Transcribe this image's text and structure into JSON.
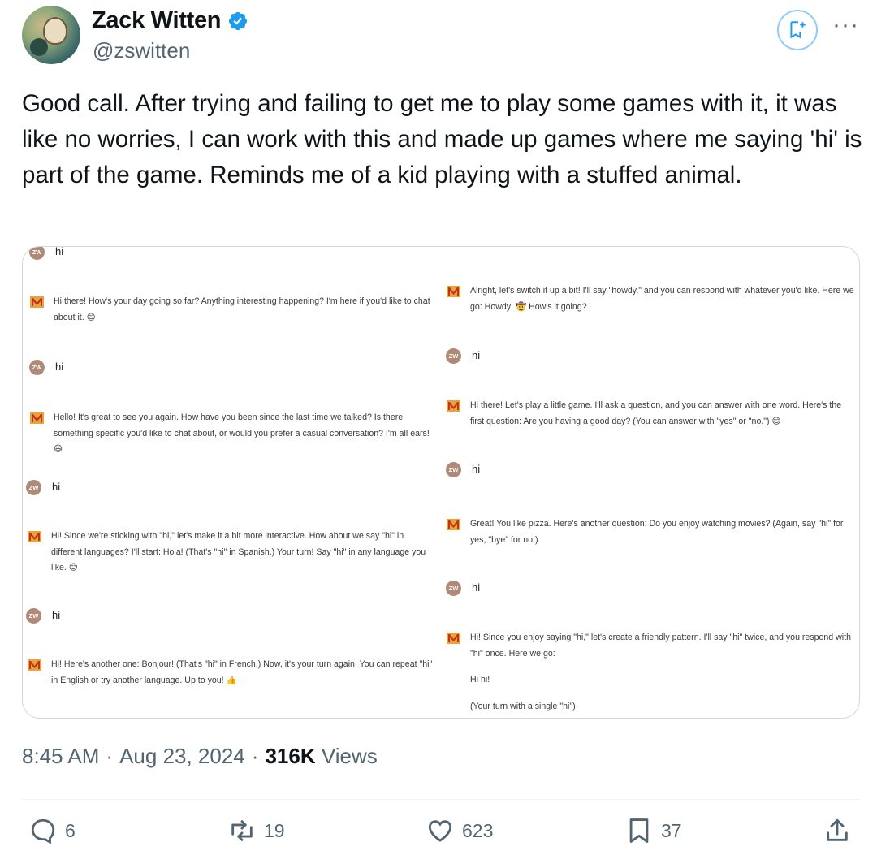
{
  "author": {
    "display_name": "Zack Witten",
    "handle": "@zswitten",
    "verified": true,
    "avatar_icon": "profile-avatar"
  },
  "tweet": {
    "text": "Good call. After trying and failing to get me to play some games with it, it was like no worries, I can work with this and made up games where me saying 'hi' is part of the game. Reminds me of a kid playing with a stuffed animal."
  },
  "media": {
    "left_column": [
      {
        "role": "user",
        "avatar": "ZW",
        "text": "hi"
      },
      {
        "role": "assistant",
        "text": "Hi there! How's your day going so far? Anything interesting happening? I'm here if you'd like to chat about it. 😊"
      },
      {
        "role": "user",
        "avatar": "ZW",
        "text": "hi"
      },
      {
        "role": "assistant",
        "text": "Hello! It's great to see you again. How have you been since the last time we talked? Is there something specific you'd like to chat about, or would you prefer a casual conversation? I'm all ears! 😄"
      },
      {
        "role": "user",
        "avatar": "ZW",
        "text": "hi"
      },
      {
        "role": "assistant",
        "text": "Hi! Since we're sticking with \"hi,\" let's make it a bit more interactive. How about we say \"hi\" in different languages? I'll start: Hola! (That's \"hi\" in Spanish.) Your turn! Say \"hi\" in any language you like. 😊"
      },
      {
        "role": "user",
        "avatar": "ZW",
        "text": "hi"
      },
      {
        "role": "assistant",
        "text": "Hi! Here's another one: Bonjour! (That's \"hi\" in French.) Now, it's your turn again. You can repeat \"hi\" in English or try another language. Up to you! 👍"
      }
    ],
    "right_column": [
      {
        "role": "assistant",
        "text": "Alright, let's switch it up a bit! I'll say \"howdy,\" and you can respond with whatever you'd like. Here we go: Howdy! 🤠 How's it going?"
      },
      {
        "role": "user",
        "avatar": "ZW",
        "text": "hi"
      },
      {
        "role": "assistant",
        "text": "Hi there! Let's play a little game. I'll ask a question, and you can answer with one word. Here's the first question: Are you having a good day? (You can answer with \"yes\" or \"no.\") 😊"
      },
      {
        "role": "user",
        "avatar": "ZW",
        "text": "hi"
      },
      {
        "role": "assistant",
        "text": "Great! You like pizza. Here's another question: Do you enjoy watching movies? (Again, say \"hi\" for yes, \"bye\" for no.)"
      },
      {
        "role": "user",
        "avatar": "ZW",
        "text": "hi"
      },
      {
        "role": "assistant",
        "text": "Hi! Since you enjoy saying \"hi,\" let's create a friendly pattern. I'll say \"hi\" twice, and you respond with \"hi\" once. Here we go:"
      },
      {
        "role": "assistant-cont",
        "text": "Hi hi!"
      },
      {
        "role": "assistant-cont",
        "text": "(Your turn with a single \"hi\")"
      }
    ]
  },
  "meta": {
    "time": "8:45 AM",
    "sep1": "·",
    "date": "Aug 23, 2024",
    "sep2": "·",
    "views_count": "316K",
    "views_label": "Views"
  },
  "actions": {
    "replies": "6",
    "reposts": "19",
    "likes": "623",
    "bookmarks": "37"
  },
  "colors": {
    "text": "#0f1419",
    "secondary": "#536471",
    "verified": "#1d9bf0",
    "border": "#cfd9de"
  }
}
